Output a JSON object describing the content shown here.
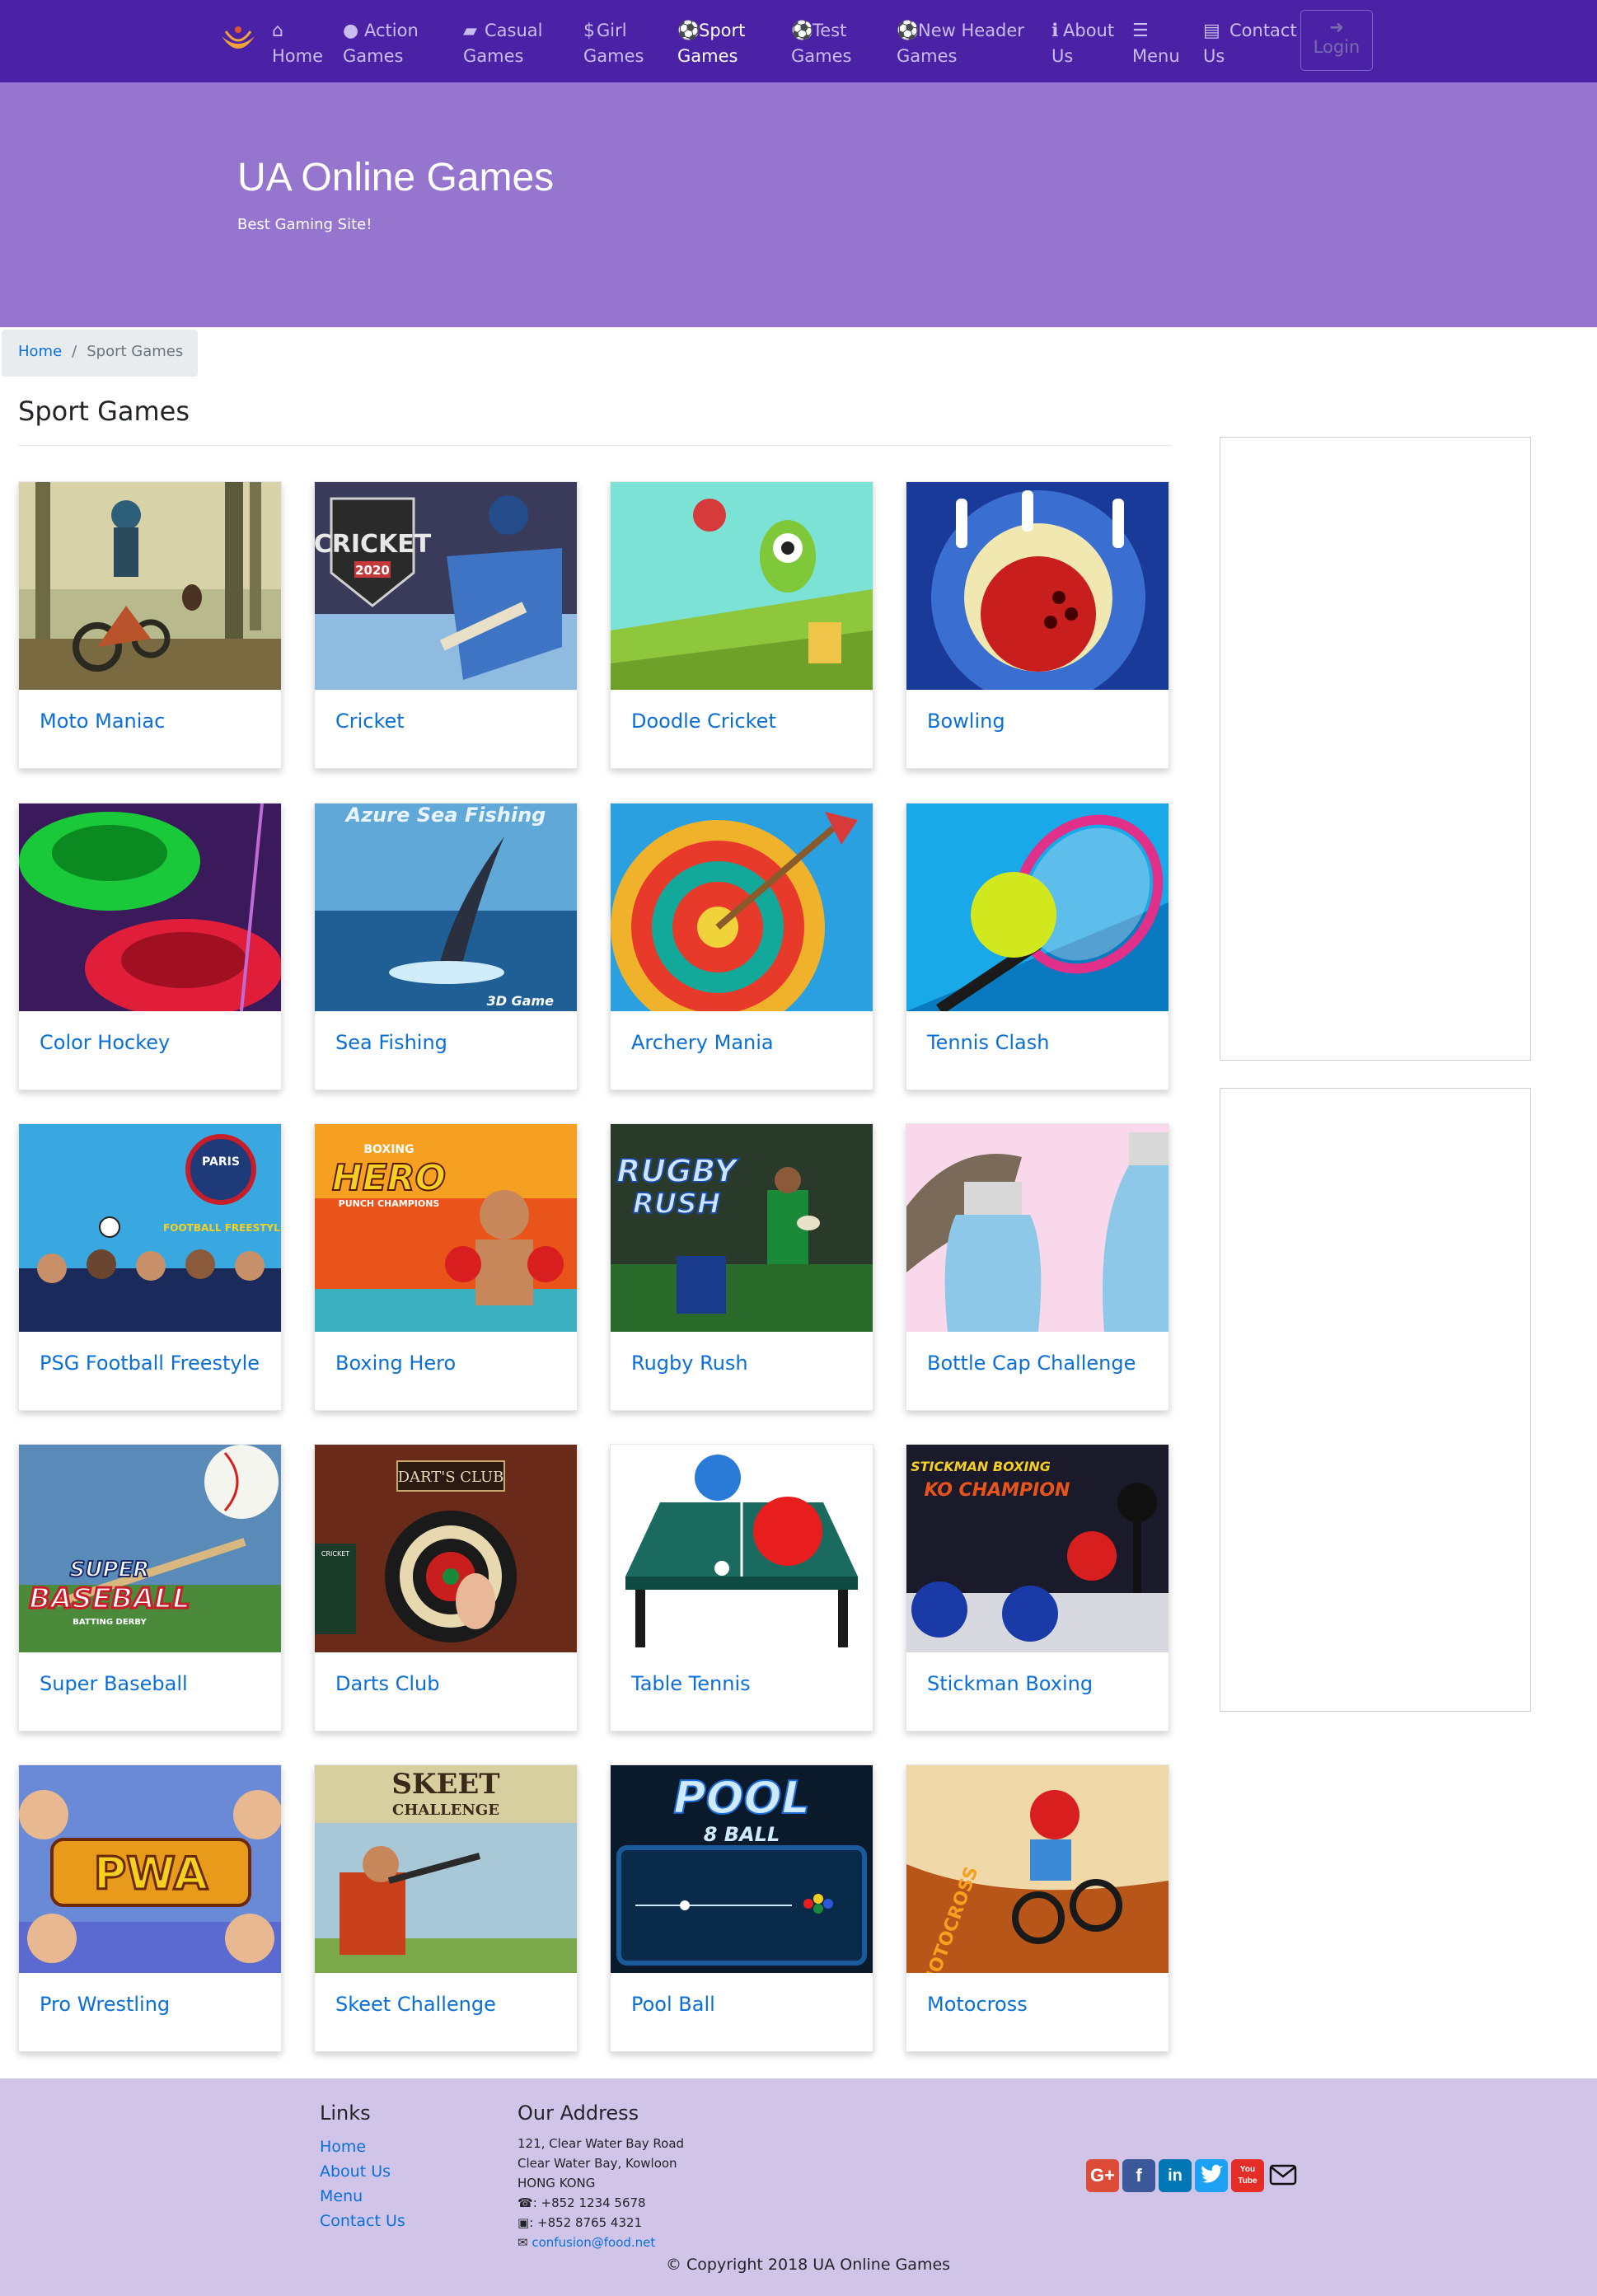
{
  "nav": {
    "items": [
      {
        "icon": "home-icon",
        "line1": "Home",
        "line2": ""
      },
      {
        "icon": "bomb-icon",
        "line1": "Action",
        "line2": "Games"
      },
      {
        "icon": "gamepad-icon",
        "line1": "Casual",
        "line2": "Games"
      },
      {
        "icon": "dollar-icon",
        "line1": "Girl",
        "line2": "Games"
      },
      {
        "icon": "soccer-ball-icon",
        "line1": "Sport",
        "line2": "Games"
      },
      {
        "icon": "soccer-ball-icon",
        "line1": "Test",
        "line2": "Games"
      },
      {
        "icon": "soccer-ball-icon",
        "line1": "New Header",
        "line2": "Games"
      },
      {
        "icon": "info-icon",
        "line1": "About",
        "line2": "Us"
      },
      {
        "icon": "list-icon",
        "line1": "Menu",
        "line2": ""
      },
      {
        "icon": "address-card-icon",
        "line1": "Contact",
        "line2": "Us"
      }
    ],
    "active": "Sport",
    "login": "Login"
  },
  "jumbotron": {
    "title": "UA Online Games",
    "subtitle": "Best Gaming Site!"
  },
  "breadcrumb": {
    "home": "Home",
    "current": "Sport Games"
  },
  "main": {
    "heading": "Sport Games",
    "games": [
      "Moto Maniac",
      "Cricket",
      "Doodle Cricket",
      "Bowling",
      "Color Hockey",
      "Sea Fishing",
      "Archery Mania",
      "Tennis Clash",
      "PSG Football Freestyle",
      "Boxing Hero",
      "Rugby Rush",
      "Bottle Cap Challenge",
      "Super Baseball",
      "Darts Club",
      "Table Tennis",
      "Stickman Boxing",
      "Pro Wrestling",
      "Skeet Challenge",
      "Pool Ball",
      "Motocross"
    ],
    "thumb_text": {
      "cricket": "CRICKET",
      "cricket_year": "2020",
      "sea_fishing": "Azure Sea Fishing",
      "sea_fishing_badge": "3D Game",
      "psg": "PARIS",
      "psg_sub": "FOOTBALL FREESTYLE",
      "boxing_top": "BOXING",
      "boxing": "HERO",
      "boxing_sub": "PUNCH CHAMPIONS",
      "rugby": "RUGBY",
      "rugby2": "RUSH",
      "baseball1": "SUPER",
      "baseball2": "BASEBALL",
      "baseball3": "BATTING DERBY",
      "darts": "DART'S CLUB",
      "darts_board": "CRICKET",
      "stickman1": "STICKMAN BOXING",
      "stickman2": "KO CHAMPION",
      "pwa": "PWA",
      "skeet1": "SKEET",
      "skeet2": "CHALLENGE",
      "pool": "POOL",
      "pool2": "8 BALL",
      "motocross": "MOTOCROSS"
    }
  },
  "footer": {
    "links_heading": "Links",
    "links": [
      "Home",
      "About Us",
      "Menu",
      "Contact Us"
    ],
    "address_heading": "Our Address",
    "address": [
      "121, Clear Water Bay Road",
      "Clear Water Bay, Kowloon",
      "HONG KONG"
    ],
    "phone": ": +852 1234 5678",
    "fax": ": +852 8765 4321",
    "email": "confusion@food.net",
    "social": [
      {
        "icon": "google-plus-icon",
        "label": "G+",
        "color": "#dd4b39"
      },
      {
        "icon": "facebook-icon",
        "label": "f",
        "color": "#3b5998"
      },
      {
        "icon": "linkedin-icon",
        "label": "in",
        "color": "#0077b5"
      },
      {
        "icon": "twitter-icon",
        "label": "t",
        "color": "#1da1f2"
      },
      {
        "icon": "youtube-icon",
        "label": "You Tube",
        "color": "#e52d27"
      }
    ],
    "copyright": "© Copyright 2018 UA Online Games"
  },
  "colors": {
    "navbar": "#4b22a5",
    "jumbotron": "#9575cd",
    "footer": "#d1c4e9",
    "link": "#0a6fd8"
  }
}
